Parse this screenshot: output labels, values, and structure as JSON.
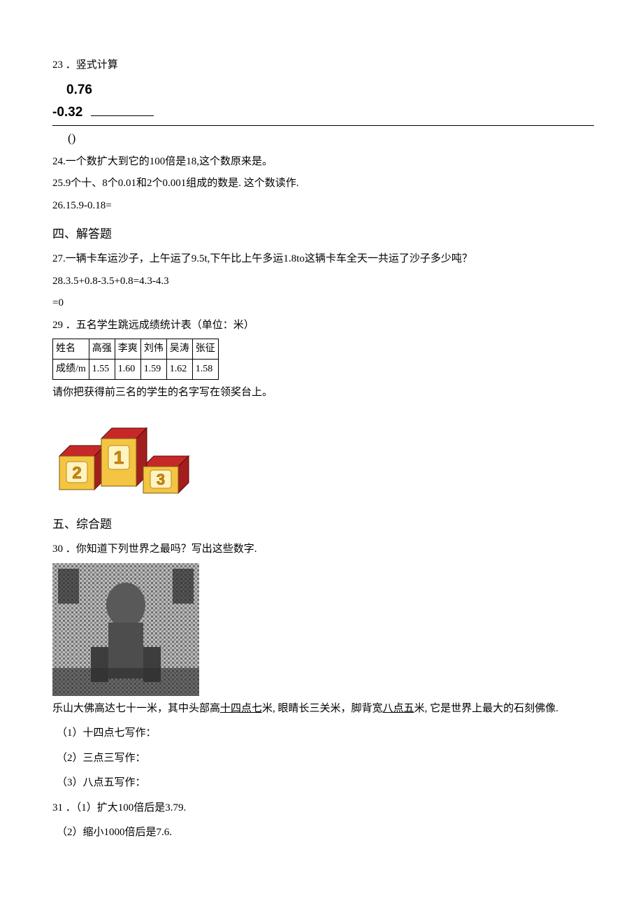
{
  "q23": {
    "num": "23",
    "title": "．竖式计算",
    "top": "0.76",
    "bottom": "-0.32",
    "paren": "()"
  },
  "q24": {
    "num": "24.",
    "text": "一个数扩大到它的100倍是18,这个数原来是。"
  },
  "q25": {
    "num": "25.",
    "text": "9个十、8个0.01和2个0.001组成的数是. 这个数读作."
  },
  "q26": {
    "num": "26.",
    "text": "15.9-0.18="
  },
  "sec4": "四、解答题",
  "q27": {
    "num": "27.",
    "text": "一辆卡车运沙子，上午运了9.5t,下午比上午多运1.8to这辆卡车全天一共运了沙子多少吨？"
  },
  "q28": {
    "line1": "28.3.5+0.8-3.5+0.8=4.3-4.3",
    "line2": "=0"
  },
  "q29": {
    "num": "29",
    "title": "．五名学生跳远成绩统计表（单位：米）",
    "after": "请你把获得前三名的学生的名字写在领奖台上。",
    "header": [
      "姓名",
      "高强",
      "李爽",
      "刘伟",
      "吴涛",
      "张征"
    ],
    "row": [
      "成绩/m",
      "1.55",
      "1.60",
      "1.59",
      "1.62",
      "1.58"
    ]
  },
  "pod": {
    "l1": "1",
    "l2": "2",
    "l3": "3"
  },
  "sec5": "五、综合题",
  "q30": {
    "num": "30",
    "title": "．你知道下列世界之最吗？写出这些数字.",
    "para_a": "乐山大佛高达七十一米，其中头部高",
    "u1": "十四点七",
    "para_b": "米, 眼睛长三关米，脚背宽",
    "u2": "八点五",
    "para_c": "米, 它是世界上最大的石刻佛像.",
    "p1": "（1）十四点七写作：",
    "p2": "（2）三点三写作：",
    "p3": "（3）八点五写作："
  },
  "q31": {
    "num": "31",
    "p1": "．（1）扩大100倍后是3.79.",
    "p2": "（2）缩小1000倍后是7.6."
  },
  "chart_data": {
    "type": "table",
    "title": "五名学生跳远成绩统计表（单位：米）",
    "categories": [
      "高强",
      "李爽",
      "刘伟",
      "吴涛",
      "张征"
    ],
    "values": [
      1.55,
      1.6,
      1.59,
      1.62,
      1.58
    ],
    "xlabel": "姓名",
    "ylabel": "成绩/m"
  }
}
